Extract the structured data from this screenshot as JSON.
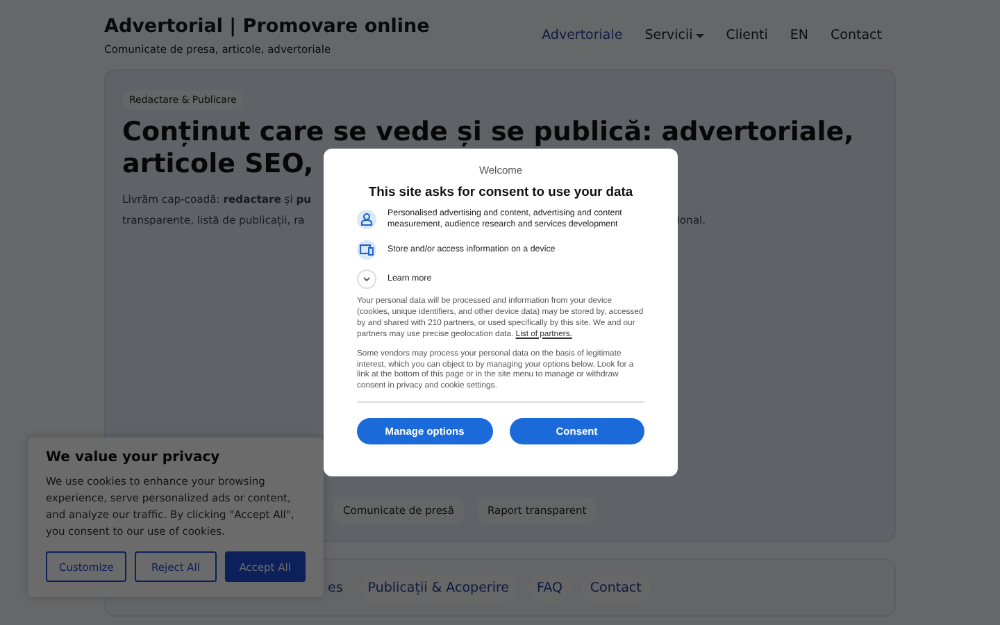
{
  "header": {
    "title": "Advertorial | Promovare online",
    "tagline": "Comunicate de presa, articole, advertoriale"
  },
  "nav": [
    {
      "label": "Advertoriale",
      "selected": true,
      "dropdown": false
    },
    {
      "label": "Servicii",
      "selected": false,
      "dropdown": true
    },
    {
      "label": "Clienti",
      "selected": false,
      "dropdown": false
    },
    {
      "label": "EN",
      "selected": false,
      "dropdown": false
    },
    {
      "label": "Contact",
      "selected": false,
      "dropdown": false
    }
  ],
  "hero": {
    "tag": "Redactare & Publicare",
    "heading_lines": [
      "Conținut care se vede și se publică: advertoriale,",
      "articole SEO,"
    ],
    "intro_lines": [
      "Livrăm cap-coadă: **redactare** și **pu**",
      "transparente, listă de publicații, ra"
    ],
    "intro_tail": "ional.",
    "chips": [
      "Comunicate de presă",
      "Raport transparent"
    ]
  },
  "footer_nav": {
    "partial": "es",
    "links": [
      "Publicații & Acoperire",
      "FAQ",
      "Contact"
    ]
  },
  "consent_dialog": {
    "welcome": "Welcome",
    "title": "This site asks for consent to use your data",
    "purposes": [
      {
        "kind": "person",
        "text": "Personalised advertising and content, advertising and content measurement, audience research and services development"
      },
      {
        "kind": "device",
        "text": "Store and/or access information on a device"
      }
    ],
    "learn_more": "Learn more",
    "paragraphs": [
      "Your personal data will be processed and information from your device (cookies, unique identifiers, and other device data) may be stored by, accessed by and shared with 210 partners, or used specifically by this site. We and our partners may use precise geolocation data.",
      "Some vendors may process your personal data on the basis of legitimate interest, which you can object to by managing your options below. Look for a link at the bottom of this page or in the site menu to manage or withdraw consent in privacy and cookie settings."
    ],
    "partners_link": "List of partners.",
    "buttons": [
      "Manage options",
      "Consent"
    ]
  },
  "cookie_banner": {
    "title": "We value your privacy",
    "text": "We use cookies to enhance your browsing experience, serve personalized ads or content, and analyze our traffic. By clicking \"Accept All\", you consent to our use of cookies.",
    "buttons": [
      {
        "label": "Customize",
        "kind": "outline"
      },
      {
        "label": "Reject All",
        "kind": "outline"
      },
      {
        "label": "Accept All",
        "kind": "filled"
      }
    ]
  }
}
